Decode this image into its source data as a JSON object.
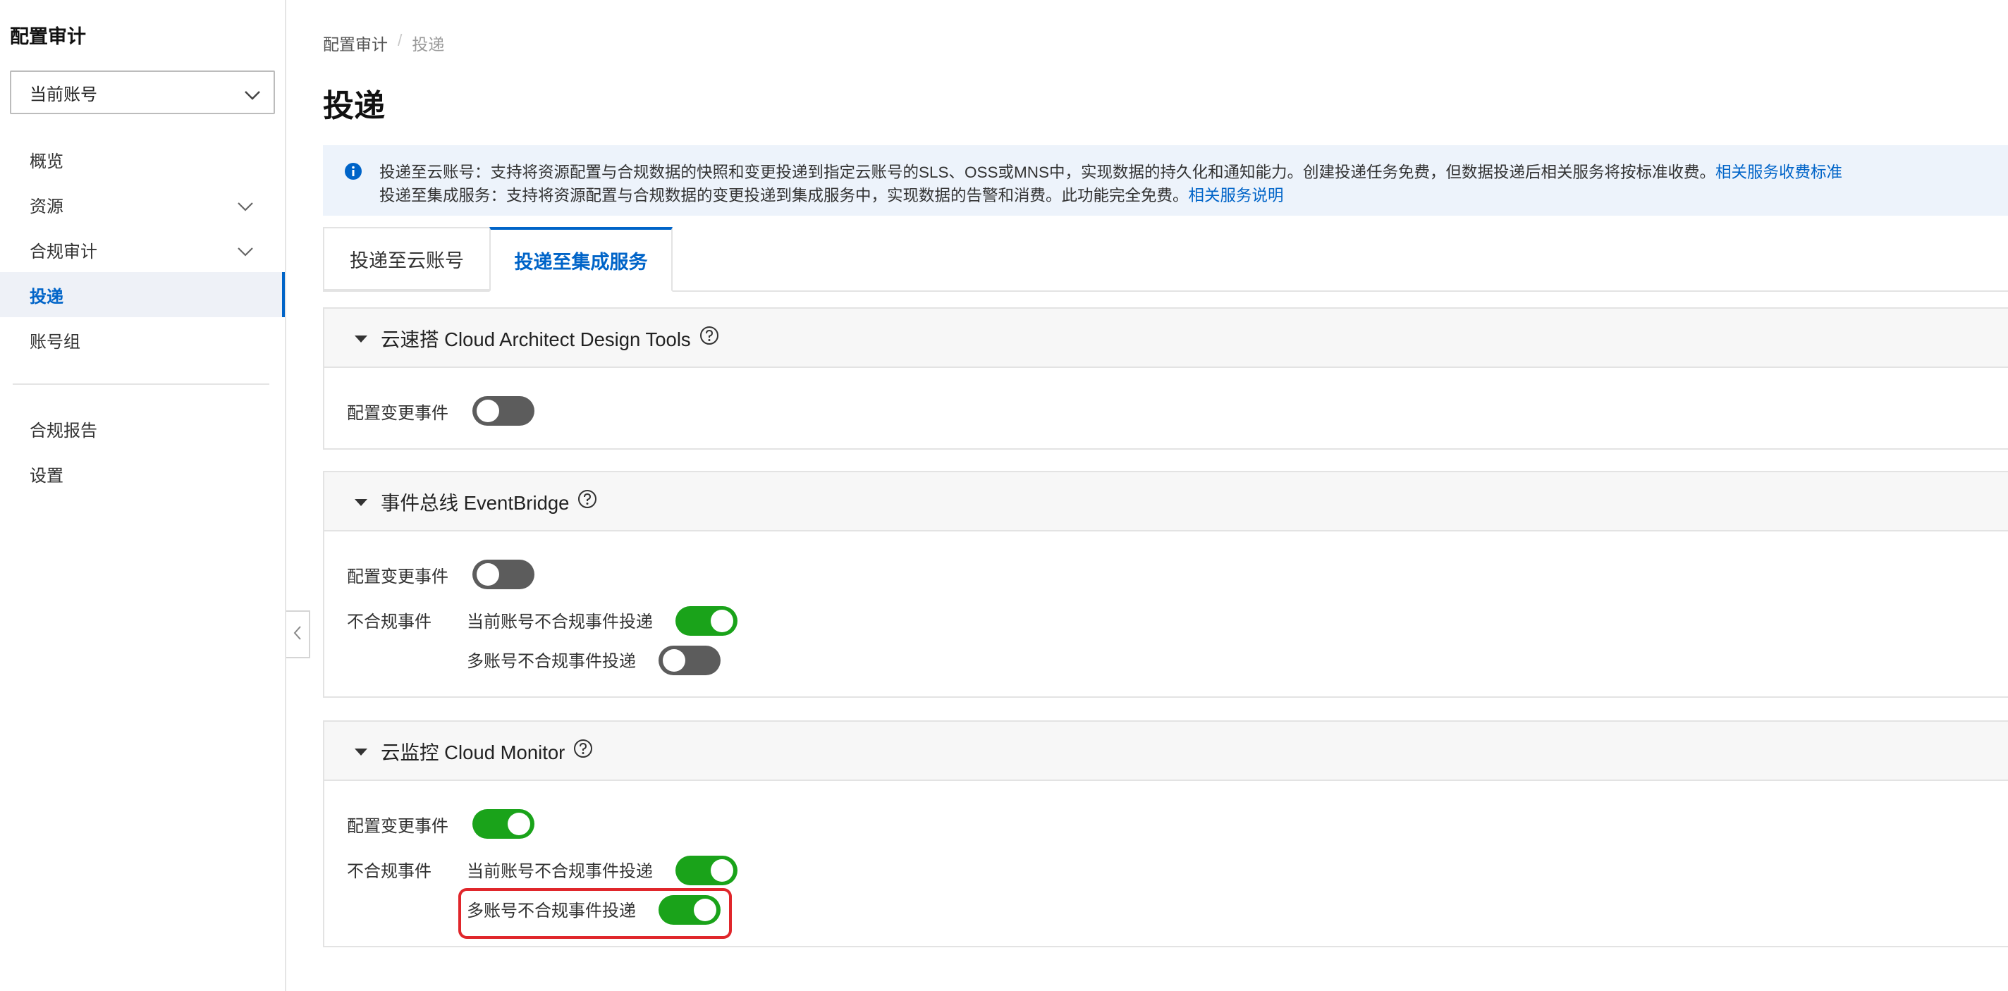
{
  "sidebar": {
    "title": "配置审计",
    "account_select": {
      "value": "当前账号"
    },
    "items": [
      {
        "label": "概览",
        "expandable": false,
        "active": false
      },
      {
        "label": "资源",
        "expandable": true,
        "active": false
      },
      {
        "label": "合规审计",
        "expandable": true,
        "active": false
      },
      {
        "label": "投递",
        "expandable": false,
        "active": true
      },
      {
        "label": "账号组",
        "expandable": false,
        "active": false
      }
    ],
    "bottom_items": [
      {
        "label": "合规报告"
      },
      {
        "label": "设置"
      }
    ]
  },
  "breadcrumb": {
    "root": "配置审计",
    "separator": "/",
    "current": "投递"
  },
  "page_title": "投递",
  "alert": {
    "line1_text": "投递至云账号：支持将资源配置与合规数据的快照和变更投递到指定云账号的SLS、OSS或MNS中，实现数据的持久化和通知能力。创建投递任务免费，但数据投递后相关服务将按标准收费。",
    "line1_link": "相关服务收费标准",
    "line2_text": "投递至集成服务：支持将资源配置与合规数据的变更投递到集成服务中，实现数据的告警和消费。此功能完全免费。",
    "line2_link": "相关服务说明"
  },
  "tabs": [
    {
      "label": "投递至云账号",
      "active": false
    },
    {
      "label": "投递至集成服务",
      "active": true
    }
  ],
  "panels": {
    "cadt": {
      "title": "云速搭 Cloud Architect Design Tools",
      "config_change_label": "配置变更事件",
      "config_change_on": false
    },
    "eventbridge": {
      "title": "事件总线 EventBridge",
      "config_change_label": "配置变更事件",
      "config_change_on": false,
      "noncompliance_label": "不合规事件",
      "current_account_label": "当前账号不合规事件投递",
      "current_account_on": true,
      "multi_account_label": "多账号不合规事件投递",
      "multi_account_on": false
    },
    "cloudmonitor": {
      "title": "云监控 Cloud Monitor",
      "config_change_label": "配置变更事件",
      "config_change_on": true,
      "noncompliance_label": "不合规事件",
      "current_account_label": "当前账号不合规事件投递",
      "current_account_on": true,
      "multi_account_label": "多账号不合规事件投递",
      "multi_account_on": true
    }
  },
  "colors": {
    "accent": "#0064c8",
    "switch_on": "#1aa31a",
    "switch_off": "#5c5c5c",
    "highlight": "#e0262b",
    "alert_bg": "#edf3fb"
  }
}
